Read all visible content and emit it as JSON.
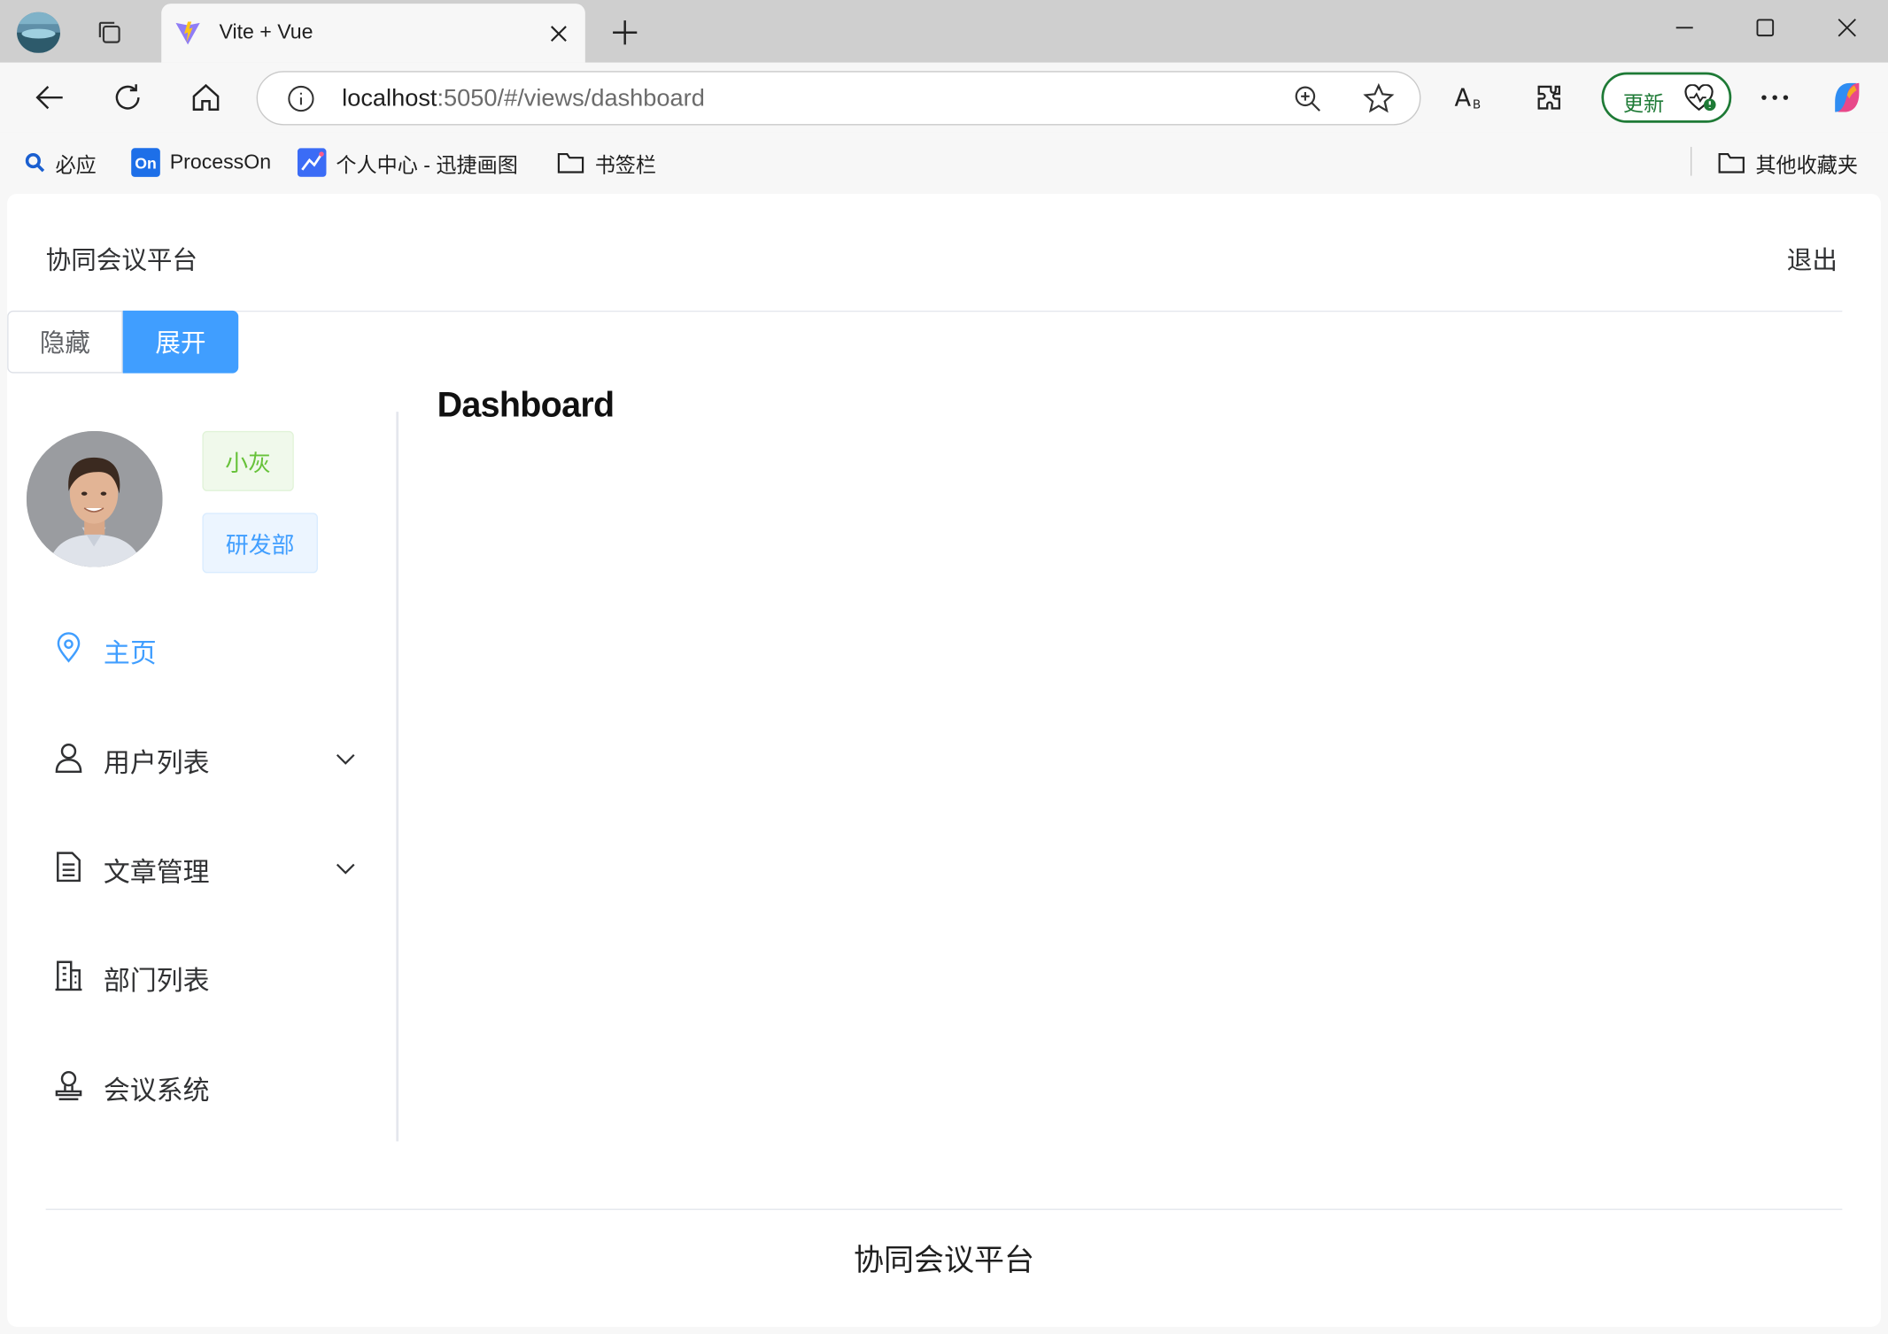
{
  "browser": {
    "tab_title": "Vite + Vue",
    "url_host": "localhost",
    "url_rest": ":5050/#/views/dashboard",
    "update_label": "更新",
    "bookmarks": [
      {
        "label": "必应",
        "icon": "search-icon"
      },
      {
        "label": "ProcessOn",
        "icon": "processon-icon"
      },
      {
        "label": "个人中心 - 迅捷画图",
        "icon": "xunjie-icon"
      },
      {
        "label": "书签栏",
        "icon": "folder-icon"
      }
    ],
    "other_bookmarks": "其他收藏夹"
  },
  "header": {
    "app_title": "协同会议平台",
    "logout": "退出"
  },
  "toggle": {
    "hide": "隐藏",
    "expand": "展开"
  },
  "user": {
    "name_tag": "小灰",
    "dept_tag": "研发部"
  },
  "menu": [
    {
      "label": "主页",
      "icon": "location-icon",
      "active": true
    },
    {
      "label": "用户列表",
      "icon": "user-icon",
      "expandable": true
    },
    {
      "label": "文章管理",
      "icon": "document-icon",
      "expandable": true
    },
    {
      "label": "部门列表",
      "icon": "office-building-icon"
    },
    {
      "label": "会议系统",
      "icon": "stamp-icon"
    }
  ],
  "main": {
    "heading": "Dashboard"
  },
  "footer": {
    "text": "协同会议平台"
  },
  "colors": {
    "primary": "#409eff",
    "success": "#67c23a",
    "edge_update": "#1e7a36"
  }
}
